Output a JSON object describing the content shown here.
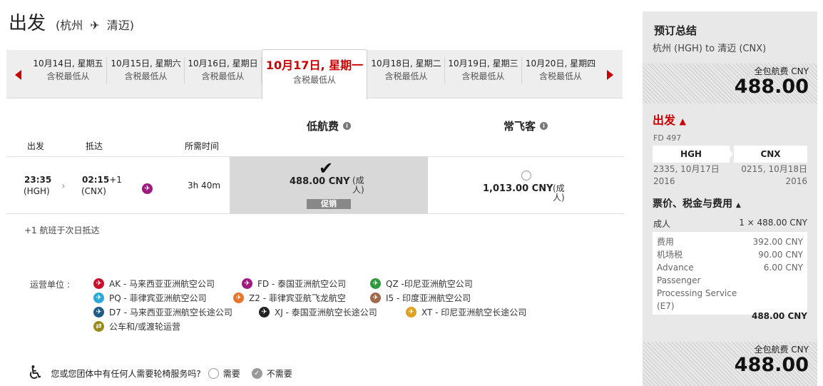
{
  "header": {
    "title": "出发",
    "route_open": "(",
    "from": "杭州",
    "to": "清迈",
    "route_close": ")"
  },
  "dates": [
    {
      "date": "10月14日, 星期五",
      "sub": "含税最低从"
    },
    {
      "date": "10月15日, 星期六",
      "sub": "含税最低从"
    },
    {
      "date": "10月16日, 星期日",
      "sub": "含税最低从"
    },
    {
      "date": "10月17日, 星期一",
      "sub": "含税最低从",
      "selected": true
    },
    {
      "date": "10月18日, 星期二",
      "sub": "含税最低从"
    },
    {
      "date": "10月19日, 星期三",
      "sub": "含税最低从"
    },
    {
      "date": "10月20日, 星期四",
      "sub": "含税最低从"
    }
  ],
  "fare_types": {
    "low": "低航费",
    "frequent": "常飞客"
  },
  "columns": {
    "depart": "出发",
    "arrive": "抵达",
    "duration": "所需时间"
  },
  "flight": {
    "dep_time": "23:35",
    "dep_code": "(HGH)",
    "arr_time": "02:15",
    "arr_plus": "+1",
    "arr_code": "(CNX)",
    "airline": "FD",
    "duration": "3h 40m",
    "low_price": "488.00 CNY",
    "low_unit": "(成人)",
    "promo": "促销",
    "freq_price": "1,013.00 CNY",
    "freq_unit": "(成人)"
  },
  "next_day_note": "+1 航班于次日抵达",
  "operators_label": "运营单位 :",
  "operators": [
    {
      "code": "AK",
      "text": "AK - 马来西亚亚洲航空公司",
      "color": "#c8102e"
    },
    {
      "code": "FD",
      "text": "FD - 泰国亚洲航空公司",
      "color": "#a0197e"
    },
    {
      "code": "QZ",
      "text": "QZ -印尼亚洲航空公司",
      "color": "#2e9a3e"
    },
    {
      "code": "PQ",
      "text": "PQ - 菲律宾亚洲航空公司",
      "color": "#2aa9d8"
    },
    {
      "code": "Z2",
      "text": "Z2 - 菲律宾亚航飞龙航空",
      "color": "#e8732a"
    },
    {
      "code": "I5",
      "text": "I5 - 印度亚洲航空公司",
      "color": "#a06a4a"
    },
    {
      "code": "D7",
      "text": "D7 - 马来西亚亚洲航空长途公司",
      "color": "#1f5c85"
    },
    {
      "code": "XJ",
      "text": "XJ - 泰国亚洲航空长途公司",
      "color": "#222222"
    },
    {
      "code": "XT",
      "text": "XT - 印尼亚洲航空长途公司",
      "color": "#e0a020"
    },
    {
      "code": "BUS",
      "text": "公车和/或渡轮运营",
      "color": "#9a8a1a"
    }
  ],
  "wheelchair": {
    "question": "您或您团体中有任何人需要轮椅服务吗?",
    "yes": "需要",
    "no": "不需要"
  },
  "summary": {
    "title": "预订总结",
    "route": "杭州 (HGH) to 清迈 (CNX)",
    "total_label": "全包航费 CNY",
    "total": "488.00",
    "depart_title": "出发",
    "flight_no": "FD 497",
    "from_code": "HGH",
    "to_code": "CNX",
    "dep_time": "2335, 10月17日",
    "dep_year": "2016",
    "arr_time": "0215, 10月18日",
    "arr_year": "2016",
    "fees_title": "票价、税金与费用",
    "adult_label": "成人",
    "adult_value": "1 × 488.00 CNY",
    "fees": [
      {
        "label": "费用",
        "value": "392.00 CNY"
      },
      {
        "label": "机场税",
        "value": "90.00 CNY"
      },
      {
        "label": "Advance Passenger Processing Service (E7)",
        "value": "6.00 CNY"
      }
    ],
    "subtotal": "488.00 CNY"
  }
}
